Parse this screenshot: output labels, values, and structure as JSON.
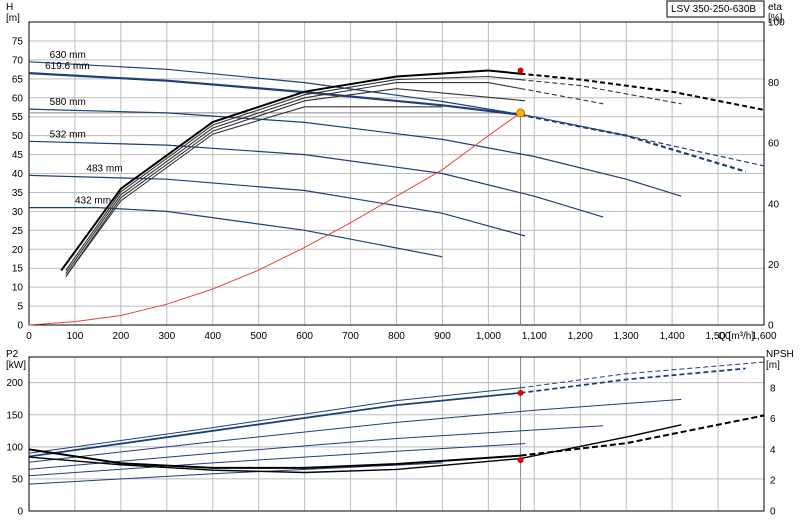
{
  "chart_data": [
    {
      "type": "line",
      "title": "LSV 350-250-630B",
      "xlabel": "Q [m³/h]",
      "ylabel": "H [m]",
      "y2label": "eta [%]",
      "xlim": [
        0,
        1600
      ],
      "ylim": [
        0,
        80
      ],
      "y2lim": [
        0,
        100
      ],
      "x_ticks": [
        "0",
        "100",
        "200",
        "300",
        "400",
        "500",
        "600",
        "700",
        "800",
        "900",
        "1,000",
        "1,100",
        "1,200",
        "1,300",
        "1,400",
        "1,500",
        "1,600"
      ],
      "y_ticks": [
        "0",
        "5",
        "10",
        "15",
        "20",
        "25",
        "30",
        "35",
        "40",
        "45",
        "50",
        "55",
        "60",
        "65",
        "70",
        "75"
      ],
      "y2_ticks": [
        "0",
        "20",
        "40",
        "60",
        "80",
        "100"
      ],
      "grid": true,
      "head_curves": [
        {
          "name": "630 mm",
          "x": [
            0,
            300,
            600,
            900,
            1100,
            1300,
            1450,
            1600
          ],
          "y": [
            69.5,
            67.5,
            64,
            59,
            55,
            50,
            46,
            42
          ]
        },
        {
          "name": "619.6 mm",
          "x": [
            0,
            300,
            600,
            900,
            1070,
            1300,
            1560
          ],
          "y": [
            66.5,
            64.5,
            61.5,
            58,
            55.5,
            50,
            40.5
          ]
        },
        {
          "name": "580 mm",
          "x": [
            0,
            300,
            600,
            900,
            1100,
            1300,
            1420
          ],
          "y": [
            57,
            56,
            53.5,
            49,
            44.5,
            38.5,
            34
          ]
        },
        {
          "name": "532 mm",
          "x": [
            0,
            300,
            600,
            900,
            1100,
            1250
          ],
          "y": [
            48.5,
            47.5,
            45,
            40,
            34,
            28.5
          ]
        },
        {
          "name": "483 mm",
          "x": [
            0,
            300,
            600,
            900,
            1080
          ],
          "y": [
            39.5,
            38.5,
            35.5,
            29.5,
            23.5
          ]
        },
        {
          "name": "432 mm",
          "x": [
            0,
            150,
            300,
            600,
            900
          ],
          "y": [
            31,
            31,
            30,
            25,
            18
          ]
        }
      ],
      "efficiency_curves": [
        {
          "x": [
            70,
            200,
            400,
            600,
            800,
            1000,
            1200,
            1400,
            1600
          ],
          "y": [
            18,
            45,
            67,
            77,
            82,
            84,
            81,
            77,
            71
          ]
        },
        {
          "x": [
            80,
            200,
            400,
            600,
            800,
            1000,
            1200,
            1420
          ],
          "y": [
            18,
            44,
            66,
            76,
            81,
            82,
            79,
            73
          ]
        },
        {
          "x": [
            80,
            200,
            400,
            600,
            800,
            1000,
            1250
          ],
          "y": [
            17,
            43,
            65,
            75,
            80,
            80,
            73
          ]
        },
        {
          "x": [
            80,
            200,
            400,
            600,
            800,
            1080
          ],
          "y": [
            16,
            42,
            64,
            74,
            78,
            74
          ]
        },
        {
          "x": [
            80,
            200,
            400,
            600,
            900
          ],
          "y": [
            16,
            41,
            63,
            72,
            72
          ]
        }
      ],
      "system_curve": {
        "x": [
          0,
          100,
          200,
          300,
          400,
          500,
          600,
          700,
          800,
          900,
          1000,
          1070
        ],
        "y": [
          0,
          0.9,
          2.5,
          5.5,
          9.5,
          14.5,
          20.5,
          27,
          34,
          41,
          50,
          56
        ]
      },
      "operating_point": {
        "q": 1070,
        "h": 56,
        "eta": 84
      }
    },
    {
      "type": "line",
      "xlabel": "",
      "ylabel": "P2 [kW]",
      "y2label": "NPSH [m]",
      "xlim": [
        0,
        1600
      ],
      "ylim": [
        0,
        240
      ],
      "y2lim": [
        0,
        10
      ],
      "y_ticks": [
        "0",
        "50",
        "100",
        "150",
        "200"
      ],
      "y2_ticks": [
        "0",
        "2",
        "4",
        "6",
        "8"
      ],
      "grid": true,
      "power_curves": [
        {
          "x": [
            0,
            400,
            800,
            1070,
            1300,
            1600
          ],
          "y": [
            90,
            130,
            172,
            192,
            214,
            232
          ]
        },
        {
          "x": [
            0,
            400,
            800,
            1070,
            1300,
            1560
          ],
          "y": [
            85,
            125,
            165,
            184,
            205,
            222
          ]
        },
        {
          "x": [
            0,
            400,
            800,
            1100,
            1420
          ],
          "y": [
            76,
            108,
            138,
            157,
            174
          ]
        },
        {
          "x": [
            0,
            400,
            800,
            1250
          ],
          "y": [
            65,
            90,
            113,
            133
          ]
        },
        {
          "x": [
            0,
            400,
            800,
            1080
          ],
          "y": [
            55,
            75,
            93,
            105
          ]
        },
        {
          "x": [
            0,
            400,
            900
          ],
          "y": [
            42,
            58,
            75
          ]
        }
      ],
      "npsh_curves": [
        {
          "x": [
            0,
            200,
            400,
            600,
            800,
            1070,
            1300,
            1600
          ],
          "y": [
            4,
            3.1,
            2.8,
            2.8,
            3.05,
            3.6,
            4.4,
            6.2
          ]
        },
        {
          "x": [
            0,
            200,
            400,
            600,
            800,
            1070,
            1300,
            1420
          ],
          "y": [
            3.5,
            3,
            2.65,
            2.5,
            2.7,
            3.4,
            4.8,
            5.6
          ]
        }
      ],
      "operating_point": {
        "q": 1070,
        "p2": 184,
        "npsh": 3.3
      }
    }
  ]
}
